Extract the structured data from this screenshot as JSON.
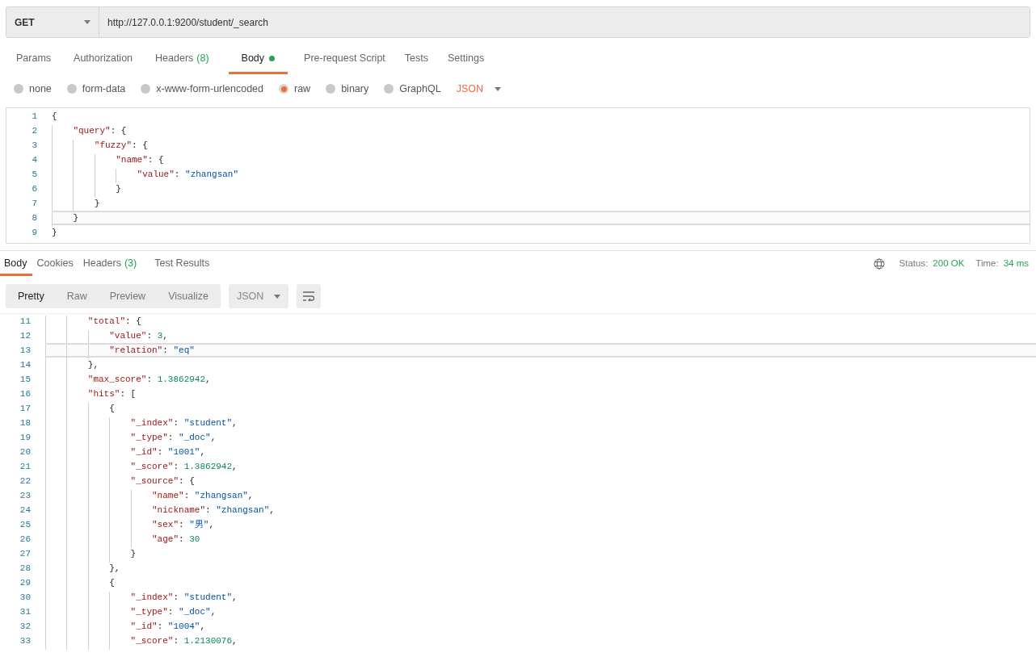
{
  "request": {
    "method": "GET",
    "url": "http://127.0.0.1:9200/student/_search",
    "tabs": [
      {
        "label": "Params",
        "selected": false
      },
      {
        "label": "Authorization",
        "selected": false
      },
      {
        "label": "Headers",
        "count": "(8)",
        "selected": false
      },
      {
        "label": "Body",
        "indicator": true,
        "selected": true
      },
      {
        "label": "Pre-request Script",
        "selected": false
      },
      {
        "label": "Tests",
        "selected": false
      },
      {
        "label": "Settings",
        "selected": false
      }
    ],
    "body_types": [
      {
        "label": "none",
        "selected": false
      },
      {
        "label": "form-data",
        "selected": false
      },
      {
        "label": "x-www-form-urlencoded",
        "selected": false
      },
      {
        "label": "raw",
        "selected": true
      },
      {
        "label": "binary",
        "selected": false
      },
      {
        "label": "GraphQL",
        "selected": false
      }
    ],
    "format": "JSON",
    "editor": [
      {
        "number": "1",
        "highlighted": false,
        "tokens": [
          {
            "kind": "punct",
            "text": "{"
          }
        ]
      },
      {
        "number": "2",
        "highlighted": false,
        "tokens": [
          {
            "kind": "key",
            "text": "    \"query\""
          },
          {
            "kind": "punct",
            "text": ": {"
          }
        ]
      },
      {
        "number": "3",
        "highlighted": false,
        "tokens": [
          {
            "kind": "key",
            "text": "        \"fuzzy\""
          },
          {
            "kind": "punct",
            "text": ": {"
          }
        ]
      },
      {
        "number": "4",
        "highlighted": false,
        "tokens": [
          {
            "kind": "key",
            "text": "            \"name\""
          },
          {
            "kind": "punct",
            "text": ": {"
          }
        ]
      },
      {
        "number": "5",
        "highlighted": false,
        "tokens": [
          {
            "kind": "key",
            "text": "                \"value\""
          },
          {
            "kind": "punct",
            "text": ": "
          },
          {
            "kind": "string",
            "text": "\"zhangsan\""
          }
        ]
      },
      {
        "number": "6",
        "highlighted": false,
        "tokens": [
          {
            "kind": "punct",
            "text": "            }"
          }
        ]
      },
      {
        "number": "7",
        "highlighted": false,
        "tokens": [
          {
            "kind": "punct",
            "text": "        }"
          }
        ]
      },
      {
        "number": "8",
        "highlighted": true,
        "tokens": [
          {
            "kind": "punct",
            "text": "    }"
          }
        ]
      },
      {
        "number": "9",
        "highlighted": false,
        "tokens": [
          {
            "kind": "punct",
            "text": "}"
          }
        ]
      }
    ]
  },
  "response": {
    "tabs": [
      {
        "label": "Body",
        "selected": true
      },
      {
        "label": "Cookies",
        "selected": false
      },
      {
        "label": "Headers",
        "count": "(3)",
        "selected": false
      },
      {
        "label": "Test Results",
        "selected": false
      }
    ],
    "status_label": "Status:",
    "status_value": "200 OK",
    "time_label": "Time:",
    "time_value": "34 ms",
    "view_modes": [
      {
        "label": "Pretty",
        "selected": true
      },
      {
        "label": "Raw",
        "selected": false
      },
      {
        "label": "Preview",
        "selected": false
      },
      {
        "label": "Visualize",
        "selected": false
      }
    ],
    "format": "JSON",
    "editor": [
      {
        "number": "11",
        "highlighted": false,
        "tokens": [
          {
            "kind": "key",
            "text": "        \"total\""
          },
          {
            "kind": "punct",
            "text": ": {"
          }
        ]
      },
      {
        "number": "12",
        "highlighted": false,
        "tokens": [
          {
            "kind": "key",
            "text": "            \"value\""
          },
          {
            "kind": "punct",
            "text": ": "
          },
          {
            "kind": "number",
            "text": "3"
          },
          {
            "kind": "punct",
            "text": ","
          }
        ]
      },
      {
        "number": "13",
        "highlighted": true,
        "tokens": [
          {
            "kind": "key",
            "text": "            \"relation\""
          },
          {
            "kind": "punct",
            "text": ": "
          },
          {
            "kind": "string",
            "text": "\"eq\""
          }
        ]
      },
      {
        "number": "14",
        "highlighted": false,
        "tokens": [
          {
            "kind": "punct",
            "text": "        },"
          }
        ]
      },
      {
        "number": "15",
        "highlighted": false,
        "tokens": [
          {
            "kind": "key",
            "text": "        \"max_score\""
          },
          {
            "kind": "punct",
            "text": ": "
          },
          {
            "kind": "number",
            "text": "1.3862942"
          },
          {
            "kind": "punct",
            "text": ","
          }
        ]
      },
      {
        "number": "16",
        "highlighted": false,
        "tokens": [
          {
            "kind": "key",
            "text": "        \"hits\""
          },
          {
            "kind": "punct",
            "text": ": ["
          }
        ]
      },
      {
        "number": "17",
        "highlighted": false,
        "tokens": [
          {
            "kind": "punct",
            "text": "            {"
          }
        ]
      },
      {
        "number": "18",
        "highlighted": false,
        "tokens": [
          {
            "kind": "key",
            "text": "                \"_index\""
          },
          {
            "kind": "punct",
            "text": ": "
          },
          {
            "kind": "string",
            "text": "\"student\""
          },
          {
            "kind": "punct",
            "text": ","
          }
        ]
      },
      {
        "number": "19",
        "highlighted": false,
        "tokens": [
          {
            "kind": "key",
            "text": "                \"_type\""
          },
          {
            "kind": "punct",
            "text": ": "
          },
          {
            "kind": "string",
            "text": "\"_doc\""
          },
          {
            "kind": "punct",
            "text": ","
          }
        ]
      },
      {
        "number": "20",
        "highlighted": false,
        "tokens": [
          {
            "kind": "key",
            "text": "                \"_id\""
          },
          {
            "kind": "punct",
            "text": ": "
          },
          {
            "kind": "string",
            "text": "\"1001\""
          },
          {
            "kind": "punct",
            "text": ","
          }
        ]
      },
      {
        "number": "21",
        "highlighted": false,
        "tokens": [
          {
            "kind": "key",
            "text": "                \"_score\""
          },
          {
            "kind": "punct",
            "text": ": "
          },
          {
            "kind": "number",
            "text": "1.3862942"
          },
          {
            "kind": "punct",
            "text": ","
          }
        ]
      },
      {
        "number": "22",
        "highlighted": false,
        "tokens": [
          {
            "kind": "key",
            "text": "                \"_source\""
          },
          {
            "kind": "punct",
            "text": ": {"
          }
        ]
      },
      {
        "number": "23",
        "highlighted": false,
        "tokens": [
          {
            "kind": "key",
            "text": "                    \"name\""
          },
          {
            "kind": "punct",
            "text": ": "
          },
          {
            "kind": "string",
            "text": "\"zhangsan\""
          },
          {
            "kind": "punct",
            "text": ","
          }
        ]
      },
      {
        "number": "24",
        "highlighted": false,
        "tokens": [
          {
            "kind": "key",
            "text": "                    \"nickname\""
          },
          {
            "kind": "punct",
            "text": ": "
          },
          {
            "kind": "string",
            "text": "\"zhangsan\""
          },
          {
            "kind": "punct",
            "text": ","
          }
        ]
      },
      {
        "number": "25",
        "highlighted": false,
        "tokens": [
          {
            "kind": "key",
            "text": "                    \"sex\""
          },
          {
            "kind": "punct",
            "text": ": "
          },
          {
            "kind": "string",
            "text": "\"男\""
          },
          {
            "kind": "punct",
            "text": ","
          }
        ]
      },
      {
        "number": "26",
        "highlighted": false,
        "tokens": [
          {
            "kind": "key",
            "text": "                    \"age\""
          },
          {
            "kind": "punct",
            "text": ": "
          },
          {
            "kind": "number",
            "text": "30"
          }
        ]
      },
      {
        "number": "27",
        "highlighted": false,
        "tokens": [
          {
            "kind": "punct",
            "text": "                }"
          }
        ]
      },
      {
        "number": "28",
        "highlighted": false,
        "tokens": [
          {
            "kind": "punct",
            "text": "            },"
          }
        ]
      },
      {
        "number": "29",
        "highlighted": false,
        "tokens": [
          {
            "kind": "punct",
            "text": "            {"
          }
        ]
      },
      {
        "number": "30",
        "highlighted": false,
        "tokens": [
          {
            "kind": "key",
            "text": "                \"_index\""
          },
          {
            "kind": "punct",
            "text": ": "
          },
          {
            "kind": "string",
            "text": "\"student\""
          },
          {
            "kind": "punct",
            "text": ","
          }
        ]
      },
      {
        "number": "31",
        "highlighted": false,
        "tokens": [
          {
            "kind": "key",
            "text": "                \"_type\""
          },
          {
            "kind": "punct",
            "text": ": "
          },
          {
            "kind": "string",
            "text": "\"_doc\""
          },
          {
            "kind": "punct",
            "text": ","
          }
        ]
      },
      {
        "number": "32",
        "highlighted": false,
        "tokens": [
          {
            "kind": "key",
            "text": "                \"_id\""
          },
          {
            "kind": "punct",
            "text": ": "
          },
          {
            "kind": "string",
            "text": "\"1004\""
          },
          {
            "kind": "punct",
            "text": ","
          }
        ]
      },
      {
        "number": "33",
        "highlighted": false,
        "tokens": [
          {
            "kind": "key",
            "text": "                \"_score\""
          },
          {
            "kind": "punct",
            "text": ": "
          },
          {
            "kind": "number",
            "text": "1.2130076"
          },
          {
            "kind": "punct",
            "text": ","
          }
        ]
      }
    ]
  }
}
